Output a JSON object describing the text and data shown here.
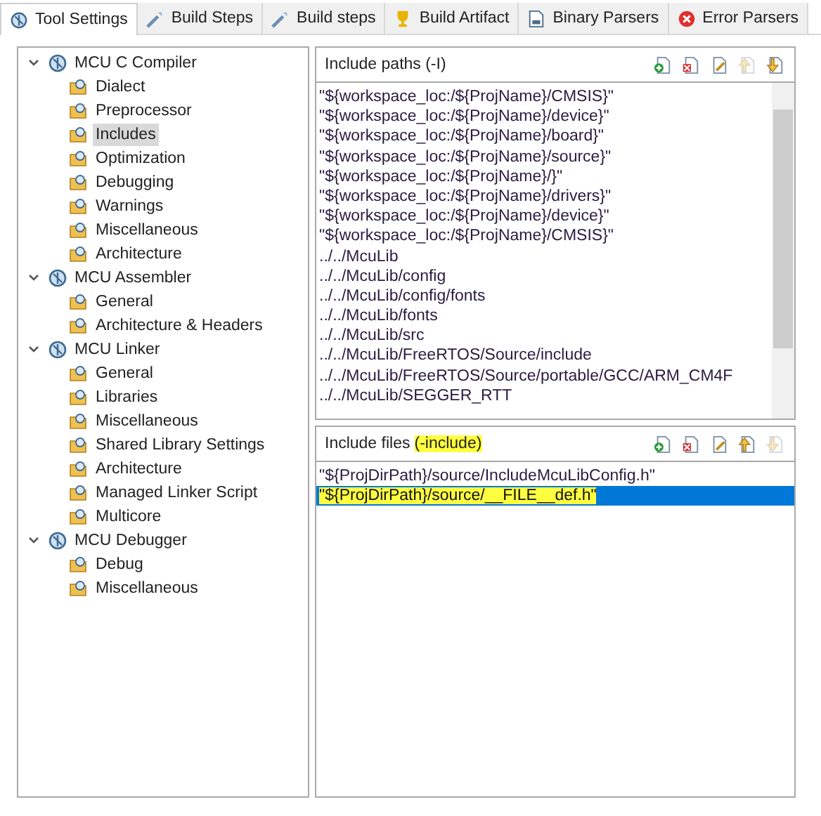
{
  "tabs": [
    {
      "label": "Tool Settings",
      "kind": "gear",
      "selected": true
    },
    {
      "label": "Build Steps",
      "kind": "wand",
      "selected": false
    },
    {
      "label": "Build steps",
      "kind": "wand",
      "selected": false
    },
    {
      "label": "Build Artifact",
      "kind": "trophy",
      "selected": false
    },
    {
      "label": "Binary Parsers",
      "kind": "document",
      "selected": false
    },
    {
      "label": "Error Parsers",
      "kind": "error",
      "selected": false
    }
  ],
  "tree": [
    {
      "label": "MCU C Compiler",
      "expanded": true,
      "selected": false,
      "children": [
        {
          "label": "Dialect",
          "selected": false
        },
        {
          "label": "Preprocessor",
          "selected": false
        },
        {
          "label": "Includes",
          "selected": true
        },
        {
          "label": "Optimization",
          "selected": false
        },
        {
          "label": "Debugging",
          "selected": false
        },
        {
          "label": "Warnings",
          "selected": false
        },
        {
          "label": "Miscellaneous",
          "selected": false
        },
        {
          "label": "Architecture",
          "selected": false
        }
      ]
    },
    {
      "label": "MCU Assembler",
      "expanded": true,
      "selected": false,
      "children": [
        {
          "label": "General",
          "selected": false
        },
        {
          "label": "Architecture & Headers",
          "selected": false
        }
      ]
    },
    {
      "label": "MCU Linker",
      "expanded": true,
      "selected": false,
      "children": [
        {
          "label": "General",
          "selected": false
        },
        {
          "label": "Libraries",
          "selected": false
        },
        {
          "label": "Miscellaneous",
          "selected": false
        },
        {
          "label": "Shared Library Settings",
          "selected": false
        },
        {
          "label": "Architecture",
          "selected": false
        },
        {
          "label": "Managed Linker Script",
          "selected": false
        },
        {
          "label": "Multicore",
          "selected": false
        }
      ]
    },
    {
      "label": "MCU Debugger",
      "expanded": true,
      "selected": false,
      "children": [
        {
          "label": "Debug",
          "selected": false
        },
        {
          "label": "Miscellaneous",
          "selected": false
        }
      ]
    }
  ],
  "panels": [
    {
      "title": "Include paths (-I)",
      "buttons": [
        {
          "kind": "add",
          "disabled": false
        },
        {
          "kind": "delete",
          "disabled": false
        },
        {
          "kind": "edit",
          "disabled": false
        },
        {
          "kind": "up",
          "disabled": true
        },
        {
          "kind": "down",
          "disabled": false
        }
      ],
      "scrollable": true,
      "rows": [
        {
          "text": "\"${workspace_loc:/${ProjName}/CMSIS}\"",
          "selected": false,
          "highlighted": false
        },
        {
          "text": "\"${workspace_loc:/${ProjName}/device}\"",
          "selected": false,
          "highlighted": false
        },
        {
          "text": "\"${workspace_loc:/${ProjName}/board}\"",
          "selected": false,
          "highlighted": false
        },
        {
          "text": "\"${workspace_loc:/${ProjName}/source}\"",
          "selected": false,
          "highlighted": false
        },
        {
          "text": "\"${workspace_loc:/${ProjName}/}\"",
          "selected": false,
          "highlighted": false
        },
        {
          "text": "\"${workspace_loc:/${ProjName}/drivers}\"",
          "selected": false,
          "highlighted": false
        },
        {
          "text": "\"${workspace_loc:/${ProjName}/device}\"",
          "selected": false,
          "highlighted": false
        },
        {
          "text": "\"${workspace_loc:/${ProjName}/CMSIS}\"",
          "selected": false,
          "highlighted": false
        },
        {
          "text": "../../McuLib",
          "selected": false,
          "highlighted": false
        },
        {
          "text": "../../McuLib/config",
          "selected": false,
          "highlighted": false
        },
        {
          "text": "../../McuLib/config/fonts",
          "selected": false,
          "highlighted": false
        },
        {
          "text": "../../McuLib/fonts",
          "selected": false,
          "highlighted": false
        },
        {
          "text": "../../McuLib/src",
          "selected": false,
          "highlighted": false
        },
        {
          "text": "../../McuLib/FreeRTOS/Source/include",
          "selected": false,
          "highlighted": false
        },
        {
          "text": "../../McuLib/FreeRTOS/Source/portable/GCC/ARM_CM4F",
          "selected": false,
          "highlighted": false
        },
        {
          "text": "../../McuLib/SEGGER_RTT",
          "selected": false,
          "highlighted": false
        }
      ]
    },
    {
      "title": "Include files",
      "title_note": {
        "text": "(-include)",
        "highlighted": true
      },
      "buttons": [
        {
          "kind": "add",
          "disabled": false
        },
        {
          "kind": "delete",
          "disabled": false
        },
        {
          "kind": "edit",
          "disabled": false
        },
        {
          "kind": "up",
          "disabled": false
        },
        {
          "kind": "down",
          "disabled": true
        }
      ],
      "scrollable": false,
      "rows": [
        {
          "text": "\"${ProjDirPath}/source/IncludeMcuLibConfig.h\"",
          "selected": false,
          "highlighted": false
        },
        {
          "text": "\"${ProjDirPath}/source/__FILE__def.h\"",
          "selected": true,
          "highlighted": true
        }
      ]
    }
  ]
}
